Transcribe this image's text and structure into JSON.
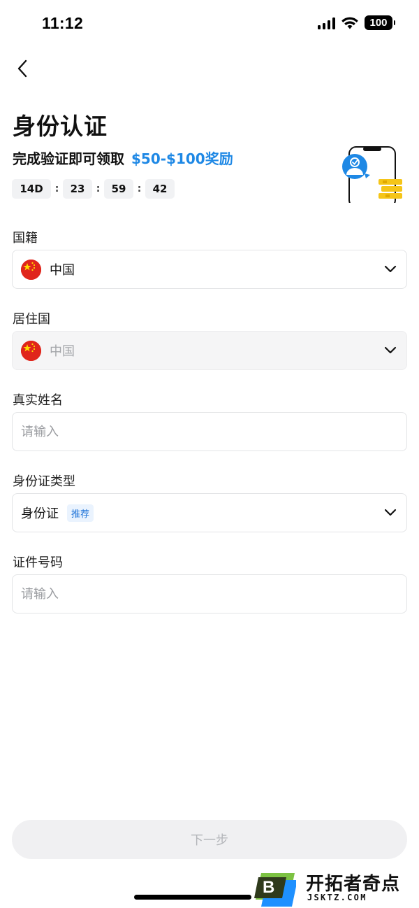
{
  "status_bar": {
    "time": "11:12",
    "battery": "100"
  },
  "header": {
    "back_icon": "chevron-left-icon",
    "title": "身份认证",
    "reward_text": "完成验证即可领取",
    "reward_amount": "$50-$100奖励",
    "accent_color": "#1e88e5"
  },
  "countdown": {
    "days": "14D",
    "hours": "23",
    "minutes": "59",
    "seconds": "42",
    "separator": ":"
  },
  "form": {
    "nationality": {
      "label": "国籍",
      "value": "中国",
      "flag": "china-flag-icon"
    },
    "residence": {
      "label": "居住国",
      "value": "中国",
      "flag": "china-flag-icon",
      "disabled": true
    },
    "real_name": {
      "label": "真实姓名",
      "placeholder": "请输入"
    },
    "id_type": {
      "label": "身份证类型",
      "value": "身份证",
      "badge": "推荐"
    },
    "id_number": {
      "label": "证件号码",
      "placeholder": "请输入"
    }
  },
  "actions": {
    "next_label": "下一步"
  },
  "watermark": {
    "name": "开拓者奇点",
    "url": "JSKTZ.COM",
    "logo_letter": "B"
  }
}
